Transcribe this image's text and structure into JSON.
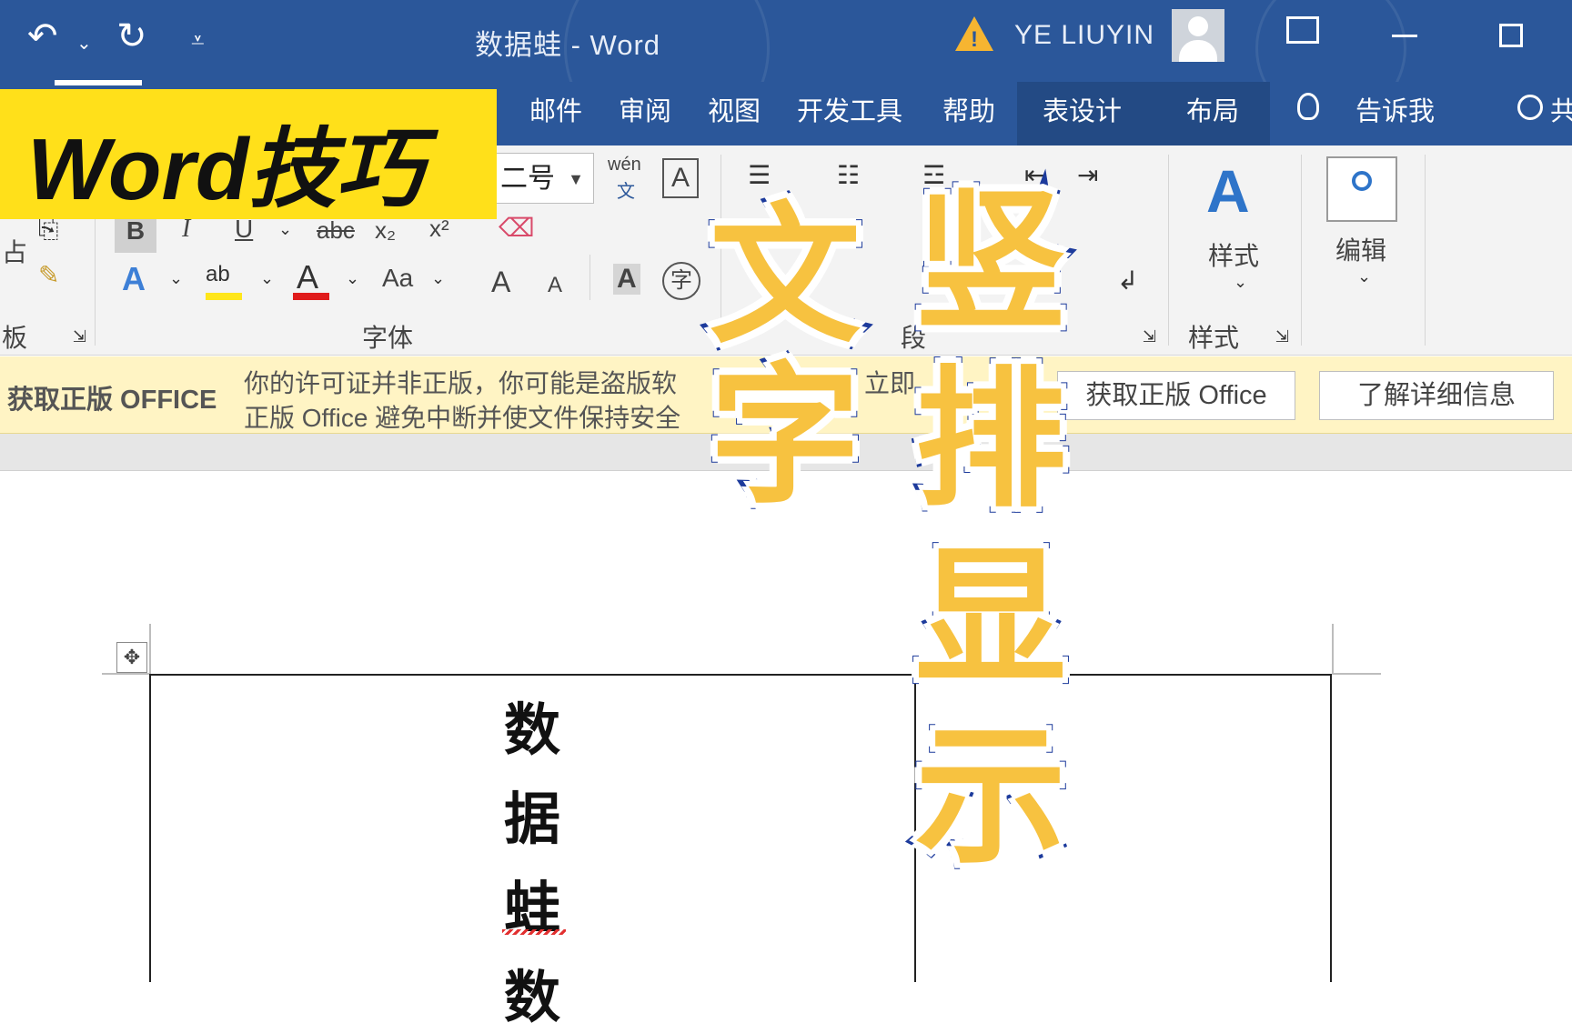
{
  "titlebar": {
    "doc_title": "数据蛙  -  Word",
    "user_name": "YE LIUYIN",
    "undo_icon": "undo-icon",
    "redo_icon": "redo-icon",
    "warning_icon": "warning-icon"
  },
  "tabs": [
    {
      "label": "邮件"
    },
    {
      "label": "审阅"
    },
    {
      "label": "视图"
    },
    {
      "label": "开发工具"
    },
    {
      "label": "帮助"
    },
    {
      "label": "表设计"
    },
    {
      "label": "布局"
    },
    {
      "label": "告诉我"
    },
    {
      "label": "共"
    }
  ],
  "ribbon": {
    "font_size": "二号",
    "phonetic_top": "wén",
    "phonetic_bottom": "文",
    "char_border": "A",
    "bold": "B",
    "italic": "I",
    "underline": "U",
    "strike": "abc",
    "sub": "x₂",
    "sup": "x²",
    "change_case": "Aa",
    "grow": "A",
    "shrink": "A",
    "enclose": "字",
    "clipboard_fragment": "板",
    "paste_fragment": "占",
    "font_group_label": "字体",
    "para_fragment": "段",
    "styles_button": "样式",
    "styles_group_label": "样式",
    "edit_button": "编辑"
  },
  "license": {
    "label": "获取正版 OFFICE",
    "message_line1": "你的许可证并非正版，你可能是盗版软",
    "message_line1_tail": "立即",
    "message_line2": "正版 Office 避免中断并使文件保持安全",
    "get_button": "获取正版 Office",
    "learn_button": "了解详细信息"
  },
  "document": {
    "cell_chars": [
      "数",
      "据",
      "蛙",
      "数"
    ]
  },
  "overlay": {
    "badge": "Word技巧",
    "col1": [
      "文",
      "字"
    ],
    "col2": [
      "竖",
      "排",
      "显",
      "示"
    ]
  },
  "colors": {
    "title_blue": "#2b579a",
    "badge_yellow": "#ffe01a",
    "overlay_fill": "#f7c240",
    "overlay_stroke": "#1d3b9c"
  }
}
